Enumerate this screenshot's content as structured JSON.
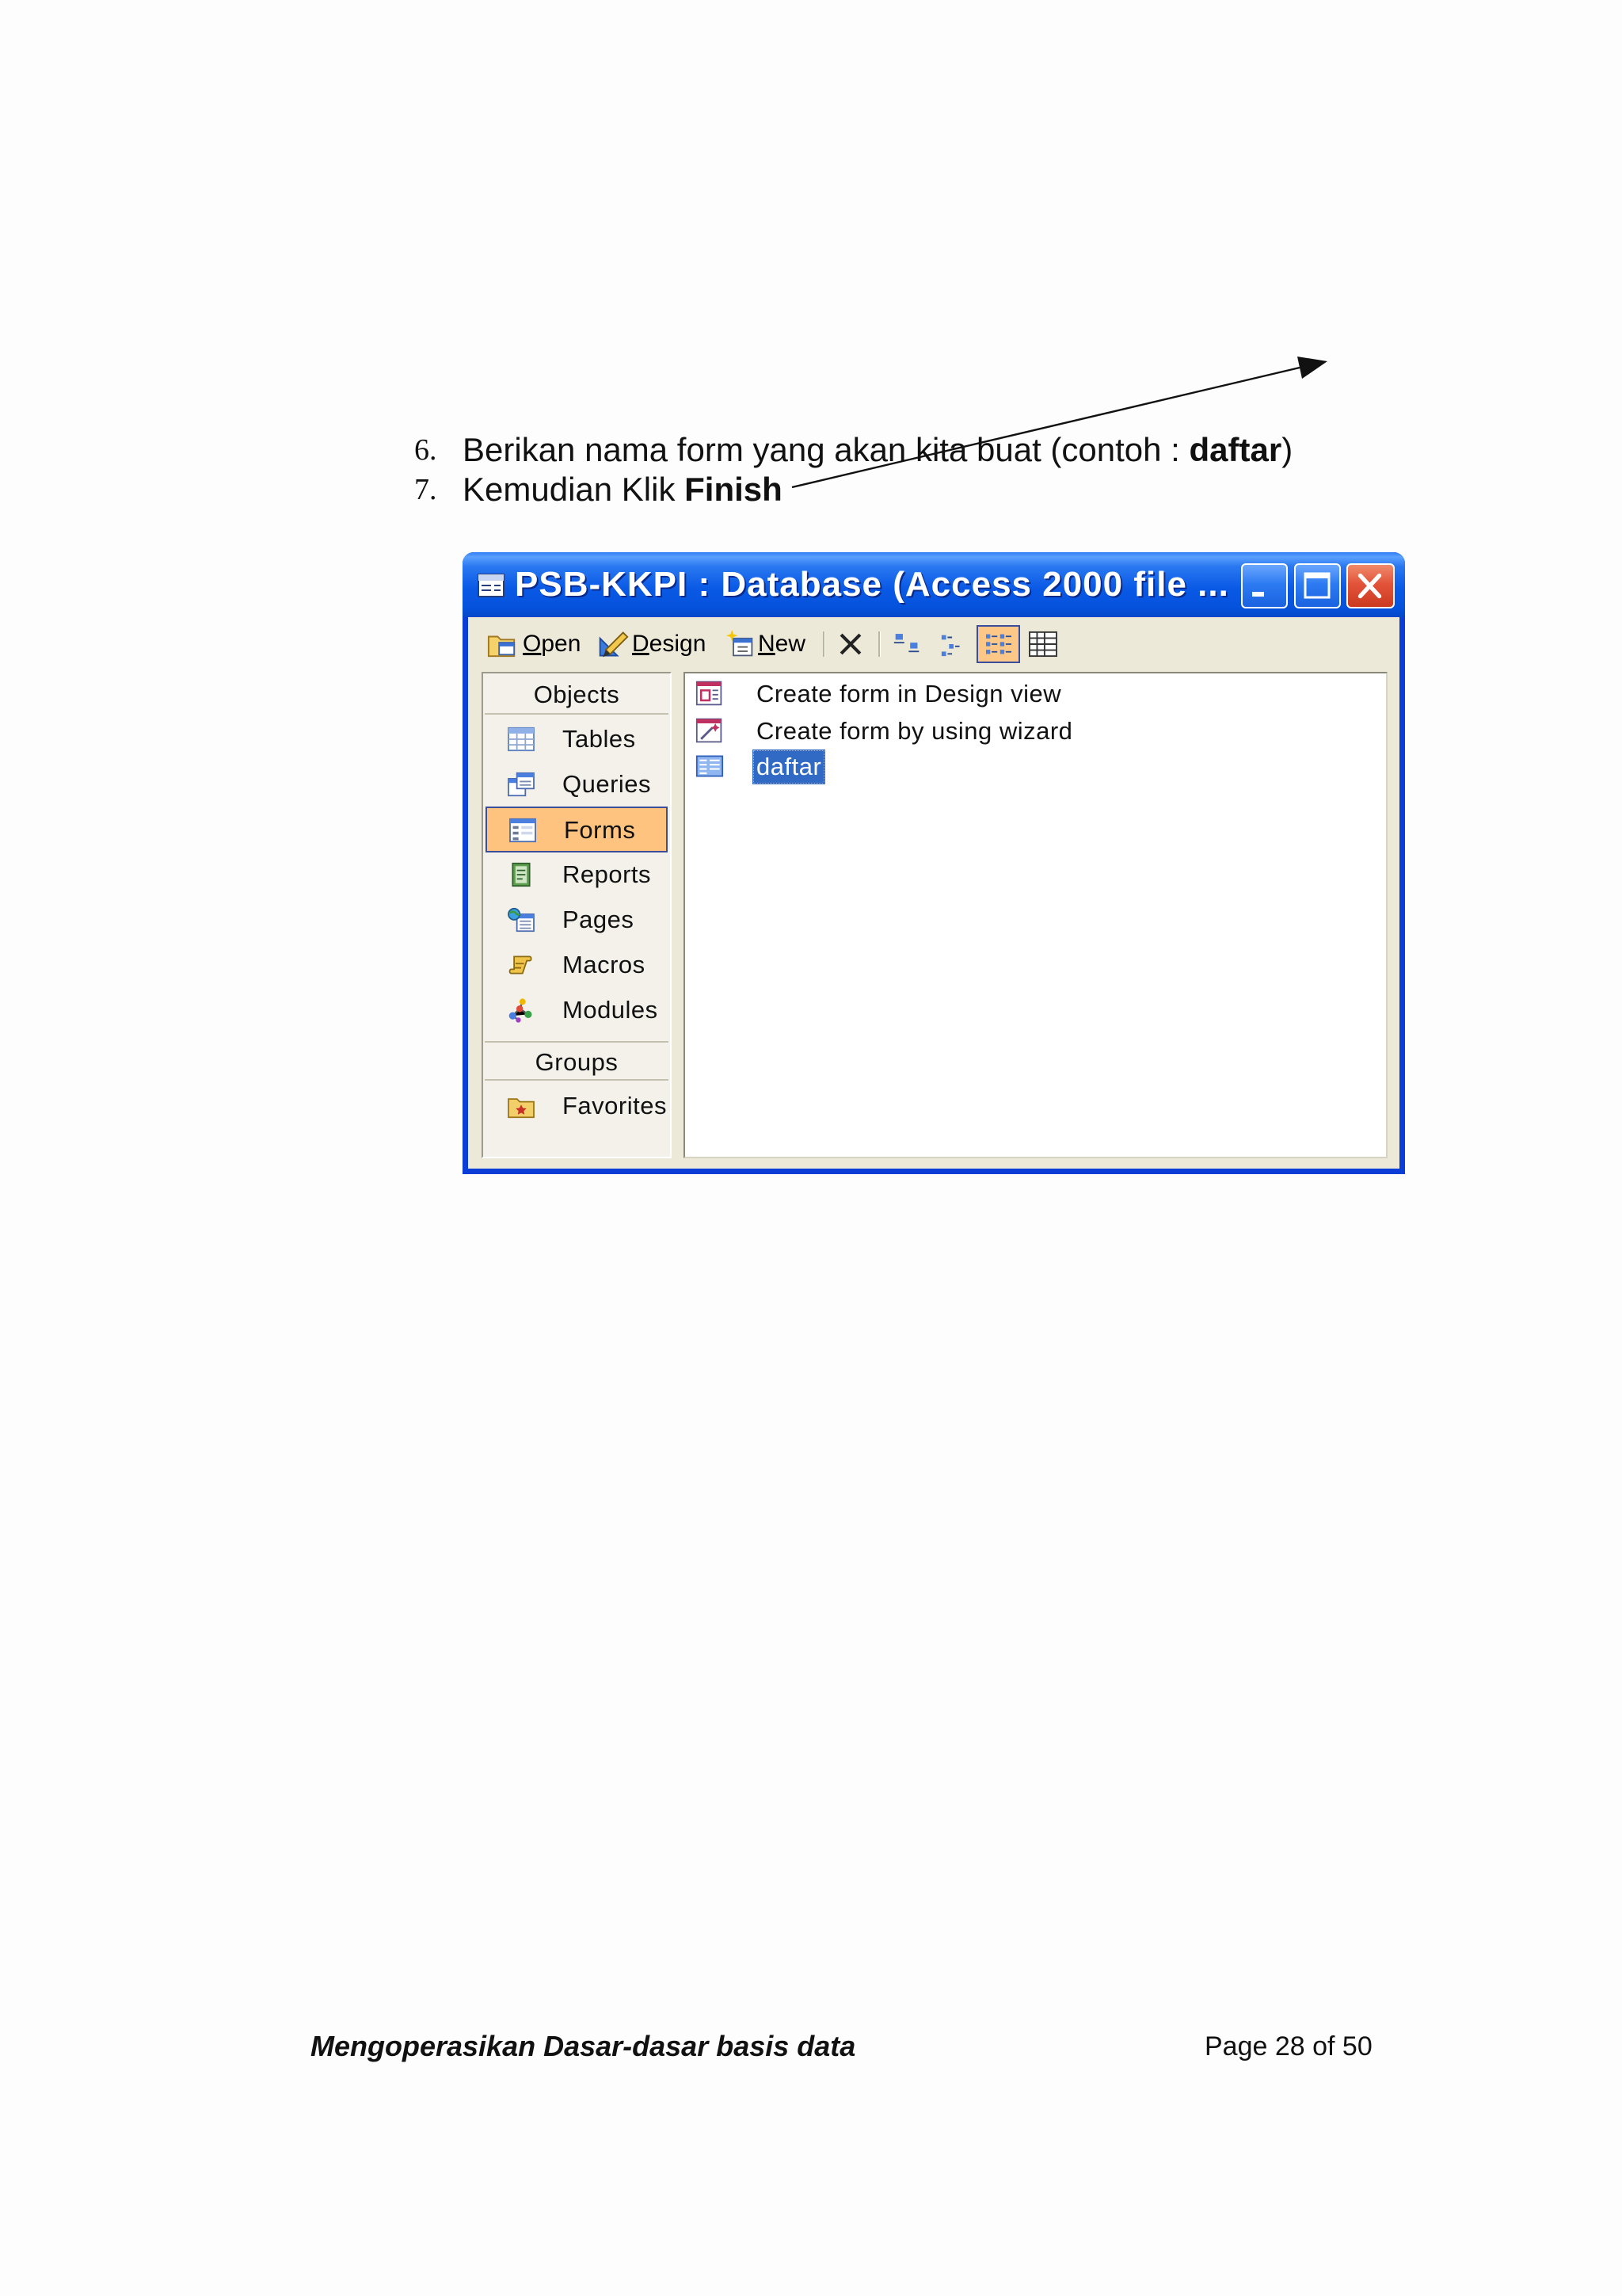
{
  "document": {
    "steps": [
      {
        "number": "6.",
        "text": "Berikan nama form yang akan kita buat (contoh : ",
        "bold": "daftar",
        "suffix": ")"
      },
      {
        "number": "7.",
        "text": "Kemudian Klik ",
        "bold": "Finish",
        "suffix": ""
      }
    ]
  },
  "window": {
    "title": "PSB-KKPI : Database (Access 2000 file ...",
    "title_icon": "database-window-icon",
    "controls": [
      "minimize-icon",
      "maximize-icon",
      "close-icon"
    ]
  },
  "toolbar": {
    "open_label": "Open",
    "design_label": "Design",
    "new_label": "New",
    "icons": [
      "open-icon",
      "design-icon",
      "new-icon",
      "delete-icon",
      "large-icons-view-icon",
      "small-icons-view-icon",
      "list-view-icon",
      "details-view-icon"
    ],
    "active_view_icon": "list-view-icon"
  },
  "sidebar": {
    "objects_header": "Objects",
    "items": [
      {
        "label": "Tables",
        "icon": "table-icon",
        "selected": false
      },
      {
        "label": "Queries",
        "icon": "query-icon",
        "selected": false
      },
      {
        "label": "Forms",
        "icon": "form-icon",
        "selected": true
      },
      {
        "label": "Reports",
        "icon": "report-icon",
        "selected": false
      },
      {
        "label": "Pages",
        "icon": "page-icon",
        "selected": false
      },
      {
        "label": "Macros",
        "icon": "macro-icon",
        "selected": false
      },
      {
        "label": "Modules",
        "icon": "module-icon",
        "selected": false
      }
    ],
    "groups_header": "Groups",
    "groups": [
      {
        "label": "Favorites",
        "icon": "favorites-folder-icon"
      }
    ]
  },
  "list": {
    "items": [
      {
        "label": "Create form in Design view",
        "icon": "design-view-shortcut-icon",
        "selected": false
      },
      {
        "label": "Create form by using wizard",
        "icon": "wizard-shortcut-icon",
        "selected": false
      },
      {
        "label": "daftar",
        "icon": "form-object-icon",
        "selected": true
      }
    ]
  },
  "footer": {
    "title": "Mengoperasikan Dasar-dasar basis data",
    "page": "Page 28 of 50"
  },
  "colors": {
    "title_bar": "#0552dc",
    "window_border": "#0a3ed6",
    "window_bg": "#ece9d8",
    "selection": "#316ac5",
    "highlight": "#fdc37f",
    "close_button": "#e2543a"
  }
}
